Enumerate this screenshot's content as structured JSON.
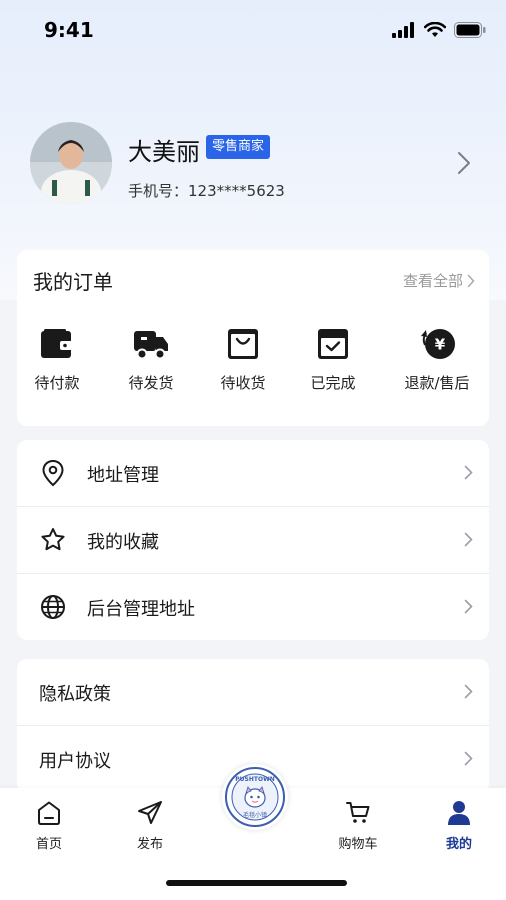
{
  "status_bar": {
    "time": "9:41"
  },
  "profile": {
    "name": "大美丽",
    "badge": "零售商家",
    "phone_label": "手机号：",
    "phone": "123****5623"
  },
  "orders": {
    "title": "我的订单",
    "view_all": "查看全部",
    "items": [
      {
        "label": "待付款",
        "icon": "wallet-icon"
      },
      {
        "label": "待发货",
        "icon": "truck-icon"
      },
      {
        "label": "待收货",
        "icon": "bag-icon"
      },
      {
        "label": "已完成",
        "icon": "box-check-icon"
      },
      {
        "label": "退款/售后",
        "icon": "refund-yen-icon"
      }
    ]
  },
  "menu": {
    "group1": [
      {
        "label": "地址管理",
        "icon": "location-pin-icon"
      },
      {
        "label": "我的收藏",
        "icon": "star-icon"
      },
      {
        "label": "后台管理地址",
        "icon": "globe-icon"
      }
    ],
    "group2": [
      {
        "label": "隐私政策"
      },
      {
        "label": "用户协议"
      }
    ]
  },
  "tabbar": {
    "tabs": [
      {
        "label": "首页",
        "icon": "home-icon",
        "active": false
      },
      {
        "label": "发布",
        "icon": "send-icon",
        "active": false
      },
      {
        "label": "购物车",
        "icon": "cart-icon",
        "active": false
      },
      {
        "label": "我的",
        "icon": "user-icon",
        "active": true
      }
    ],
    "center_logo": {
      "top_text": "PUSHTOWN",
      "bottom_text": "毛毯小镇"
    }
  },
  "colors": {
    "accent": "#2a64e8",
    "active_tab": "#1f3a93",
    "muted": "#999999"
  }
}
